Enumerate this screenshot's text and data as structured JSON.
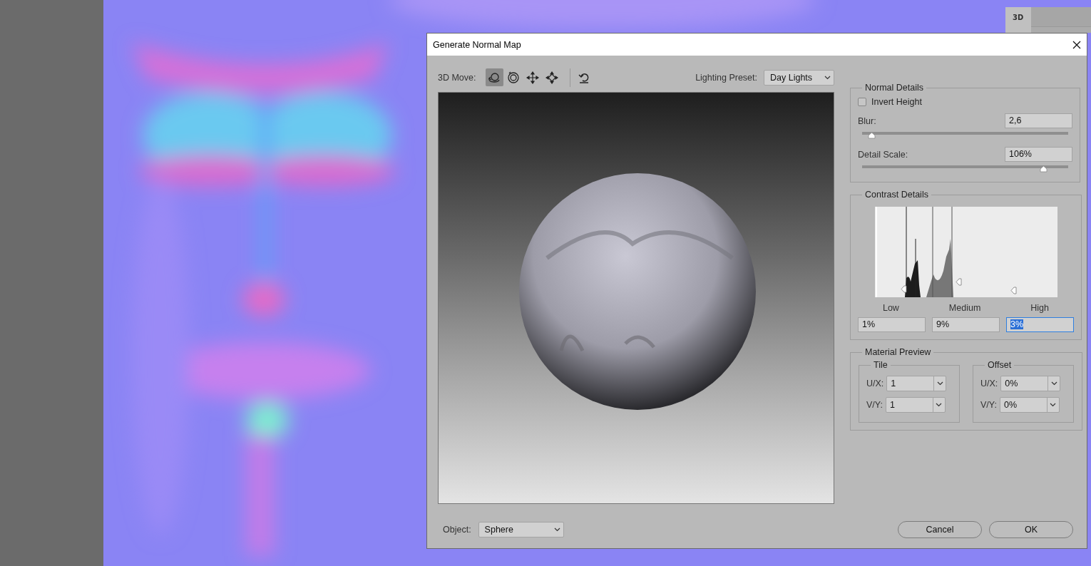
{
  "side_panel": {
    "tab": "3D"
  },
  "dialog": {
    "title": "Generate Normal Map",
    "toolbar": {
      "label": "3D Move:",
      "tools": [
        {
          "kind": "orbit",
          "selected": true
        },
        {
          "kind": "roll",
          "selected": false
        },
        {
          "kind": "pan",
          "selected": false
        },
        {
          "kind": "slide",
          "selected": false
        }
      ]
    },
    "lighting_preset": {
      "label": "Lighting Preset:",
      "value": "Day Lights"
    },
    "normal_details": {
      "title": "Normal Details",
      "invert_height": {
        "label": "Invert Height",
        "checked": false
      },
      "sliders": [
        {
          "label": "Blur:",
          "value": "2,6",
          "level": 0.045
        },
        {
          "label": "Detail Scale:",
          "value": "106%",
          "level": 0.88
        }
      ]
    },
    "contrast_details": {
      "title": "Contrast Details",
      "bands": [
        {
          "label": "Low",
          "value": "1%",
          "level": 0.16,
          "focused": false
        },
        {
          "label": "Medium",
          "value": "9%",
          "level": 0.46,
          "focused": false
        },
        {
          "label": "High",
          "value": "3%",
          "level": 0.76,
          "focused": true
        }
      ]
    },
    "material_preview": {
      "title": "Material Preview",
      "groups": [
        {
          "title": "Tile",
          "fields": [
            {
              "label": "U/X:",
              "value": "1"
            },
            {
              "label": "V/Y:",
              "value": "1"
            }
          ]
        },
        {
          "title": "Offset",
          "fields": [
            {
              "label": "U/X:",
              "value": "0%"
            },
            {
              "label": "V/Y:",
              "value": "0%"
            }
          ]
        }
      ]
    },
    "object": {
      "label": "Object:",
      "value": "Sphere"
    },
    "buttons": [
      "Cancel",
      "OK"
    ]
  }
}
